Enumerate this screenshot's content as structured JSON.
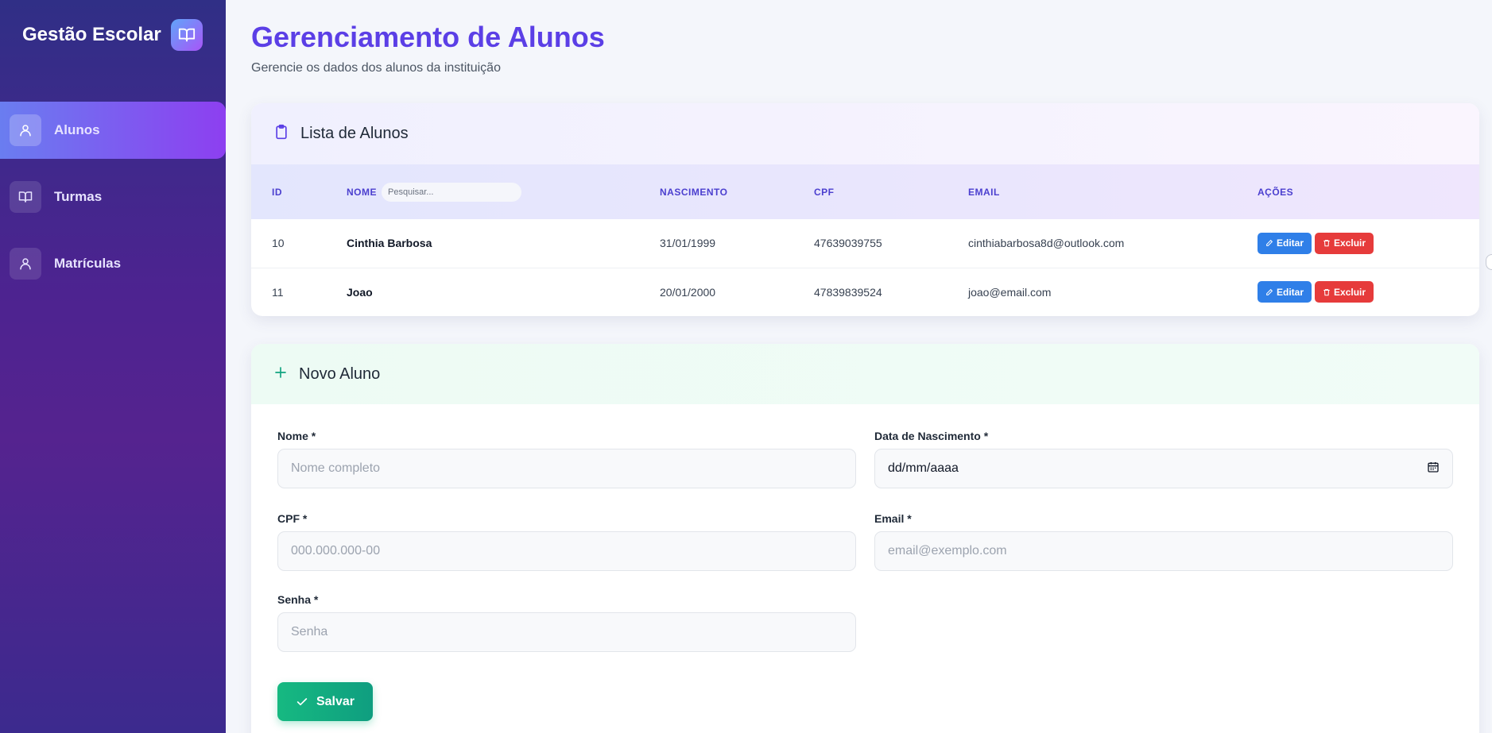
{
  "sidebar": {
    "brand": "Gestão Escolar",
    "brand_icon": "book-icon",
    "items": [
      {
        "label": "Alunos",
        "icon": "user-icon",
        "active": true
      },
      {
        "label": "Turmas",
        "icon": "book-icon",
        "active": false
      },
      {
        "label": "Matrículas",
        "icon": "user-icon",
        "active": false
      }
    ]
  },
  "header": {
    "title": "Gerenciamento de Alunos",
    "subtitle": "Gerencie os dados dos alunos da instituição"
  },
  "list": {
    "title": "Lista de Alunos",
    "icon": "clipboard-icon",
    "columns": [
      "ID",
      "NOME",
      "NASCIMENTO",
      "CPF",
      "EMAIL",
      "AÇÕES"
    ],
    "search_placeholder": "Pesquisar...",
    "rows": [
      {
        "id": "10",
        "nome": "Cinthia Barbosa",
        "nascimento": "31/01/1999",
        "cpf": "47639039755",
        "email": "cinthiabarbosa8d@outlook.com"
      },
      {
        "id": "11",
        "nome": "Joao",
        "nascimento": "20/01/2000",
        "cpf": "47839839524",
        "email": "joao@email.com"
      }
    ],
    "edit_label": "Editar",
    "delete_label": "Excluir"
  },
  "form": {
    "title": "Novo Aluno",
    "icon": "plus-icon",
    "nome_label": "Nome *",
    "nome_placeholder": "Nome completo",
    "data_label": "Data de Nascimento *",
    "data_value": "dd/mm/aaaa",
    "cpf_label": "CPF *",
    "cpf_placeholder": "000.000.000-00",
    "email_label": "Email *",
    "email_placeholder": "email@exemplo.com",
    "senha_label": "Senha *",
    "senha_placeholder": "Senha",
    "save_label": "Salvar"
  },
  "colors": {
    "accent": "#5b3fe6",
    "edit": "#2f7fe8",
    "delete": "#e63b3b",
    "save": "#16b981"
  }
}
